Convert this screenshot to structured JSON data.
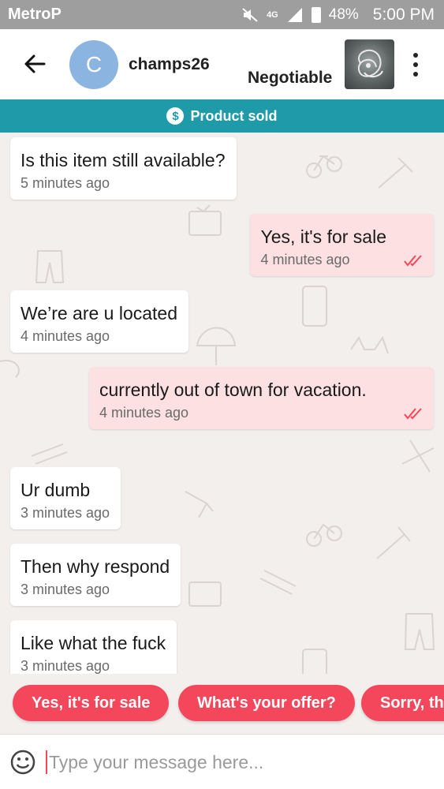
{
  "status_bar": {
    "carrier": "MetroP",
    "network": "4G",
    "battery": "48%",
    "time": "5:00 PM"
  },
  "header": {
    "avatar_letter": "C",
    "username": "champs26",
    "price_label": "Negotiable"
  },
  "banner": {
    "icon": "$",
    "label": "Product sold"
  },
  "messages": [
    {
      "direction": "in",
      "text": "Is this item still available?",
      "time": "5 minutes ago"
    },
    {
      "direction": "out",
      "text": "Yes, it's for sale",
      "time": "4 minutes ago",
      "read": true
    },
    {
      "direction": "in",
      "text": "We’re are u located",
      "time": "4 minutes ago"
    },
    {
      "direction": "out",
      "text": "currently out of town for vacation.",
      "time": "4 minutes ago",
      "read": true
    },
    {
      "direction": "in",
      "text": "Ur dumb",
      "time": "3 minutes ago"
    },
    {
      "direction": "in",
      "text": "Then why respond",
      "time": "3 minutes ago"
    },
    {
      "direction": "in",
      "text": "Like what the fuck",
      "time": "3 minutes ago"
    }
  ],
  "quick_replies": [
    "Yes, it's for sale",
    "What's your offer?",
    "Sorry, th"
  ],
  "composer": {
    "placeholder": "Type your message here..."
  },
  "colors": {
    "accent": "#f4475b",
    "banner": "#1f9aa8",
    "outgoing_bubble": "#fde0e2",
    "avatar": "#8bb4e0"
  }
}
